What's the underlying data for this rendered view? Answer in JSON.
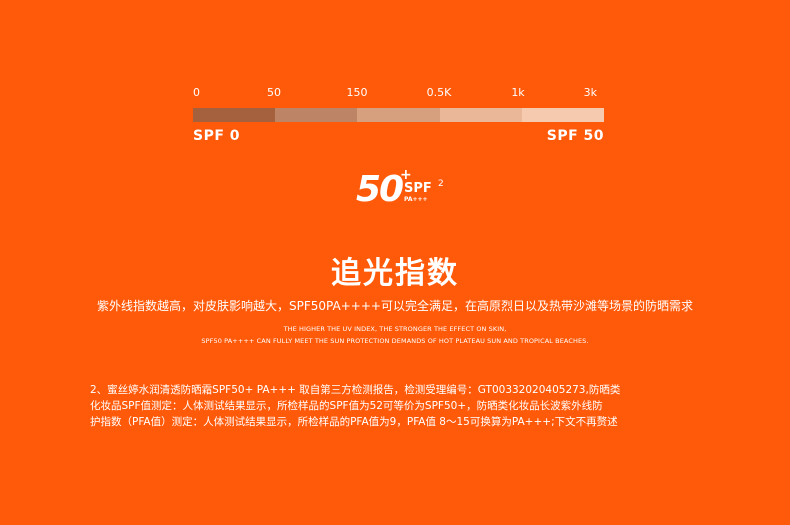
{
  "scale": {
    "ticks": [
      "0",
      "50",
      "150",
      "0.5K",
      "1k",
      "3k"
    ],
    "segment_colors": [
      "#a5603e",
      "#be8466",
      "#d6a07e",
      "#eab798",
      "#f6caae"
    ],
    "left_label": "SPF 0",
    "right_label": "SPF 50"
  },
  "badge": {
    "number": "50",
    "plus": "+",
    "spf": "SPF",
    "sup": "2",
    "pa": "PA+++"
  },
  "title": "追光指数",
  "subtitle": "紫外线指数越高，对皮肤影响越大，SPF50PA++++可以完全满足，在高原烈日以及热带沙滩等场景的防晒需求",
  "english": {
    "line1": "THE HIGHER THE UV INDEX, THE STRONGER THE EFFECT ON SKIN,",
    "line2": "SPF50 PA++++ CAN FULLY MEET THE SUN PROTECTION DEMANDS OF HOT PLATEAU SUN AND TROPICAL BEACHES."
  },
  "note": {
    "line1": "2、蜜丝婷水润清透防晒霜SPF50+ PA+++ 取自第三方检测报告，检测受理编号：GT00332020405273,防晒类",
    "line2": "化妆品SPF值测定：人体测试结果显示，所检样品的SPF值为52可等价为SPF50+，防晒类化妆品长波紫外线防",
    "line3": "护指数（PFA值）测定：人体测试结果显示，所检样品的PFA值为9，PFA值 8～15可换算为PA+++;下文不再赘述"
  }
}
